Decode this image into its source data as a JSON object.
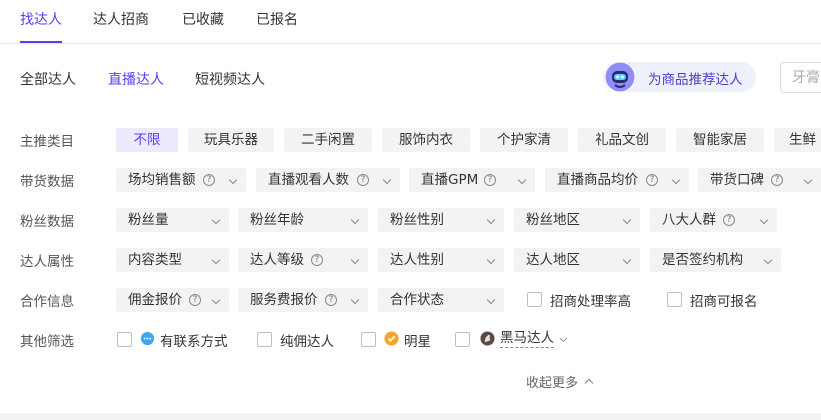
{
  "tabs": [
    {
      "label": "找达人",
      "active": true
    },
    {
      "label": "达人招商"
    },
    {
      "label": "已收藏"
    },
    {
      "label": "已报名"
    }
  ],
  "subtabs": [
    {
      "label": "全部达人"
    },
    {
      "label": "直播达人",
      "active": true
    },
    {
      "label": "短视频达人"
    }
  ],
  "recommend": {
    "label": "为商品推荐达人",
    "icon": "robot-icon"
  },
  "search": {
    "placeholder": "牙膏"
  },
  "rows": {
    "category": {
      "label": "主推类目",
      "items": [
        "不限",
        "玩具乐器",
        "二手闲置",
        "服饰内衣",
        "个护家清",
        "礼品文创",
        "智能家居",
        "生鲜"
      ],
      "selected": "不限"
    },
    "sales": {
      "label": "带货数据",
      "items": [
        {
          "label": "场均销售额",
          "help": true
        },
        {
          "label": "直播观看人数",
          "help": true
        },
        {
          "label": "直播GPM",
          "help": true
        },
        {
          "label": "直播商品均价",
          "help": true
        },
        {
          "label": "带货口碑",
          "help": true
        }
      ]
    },
    "fans": {
      "label": "粉丝数据",
      "items": [
        {
          "label": "粉丝量"
        },
        {
          "label": "粉丝年龄"
        },
        {
          "label": "粉丝性别"
        },
        {
          "label": "粉丝地区"
        },
        {
          "label": "八大人群",
          "help": true
        }
      ]
    },
    "attr": {
      "label": "达人属性",
      "items": [
        {
          "label": "内容类型"
        },
        {
          "label": "达人等级",
          "help": true
        },
        {
          "label": "达人性别"
        },
        {
          "label": "达人地区"
        },
        {
          "label": "是否签约机构"
        }
      ]
    },
    "coop": {
      "label": "合作信息",
      "items": [
        {
          "label": "佣金报价",
          "help": true
        },
        {
          "label": "服务费报价",
          "help": true
        },
        {
          "label": "合作状态"
        }
      ],
      "checks": [
        "招商处理率高",
        "招商可报名"
      ]
    },
    "other": {
      "label": "其他筛选",
      "checks": [
        {
          "label": "有联系方式",
          "icon": "chat-icon"
        },
        {
          "label": "纯佣达人"
        },
        {
          "label": "明星",
          "icon": "verified-badge-icon"
        },
        {
          "label": "黑马达人",
          "icon": "horse-icon"
        }
      ]
    }
  },
  "collapse": {
    "label": "收起更多"
  },
  "colors": {
    "accent": "#5b3df5",
    "chip_bg": "#f3f3f5",
    "chip_active_bg": "#edeafd"
  }
}
